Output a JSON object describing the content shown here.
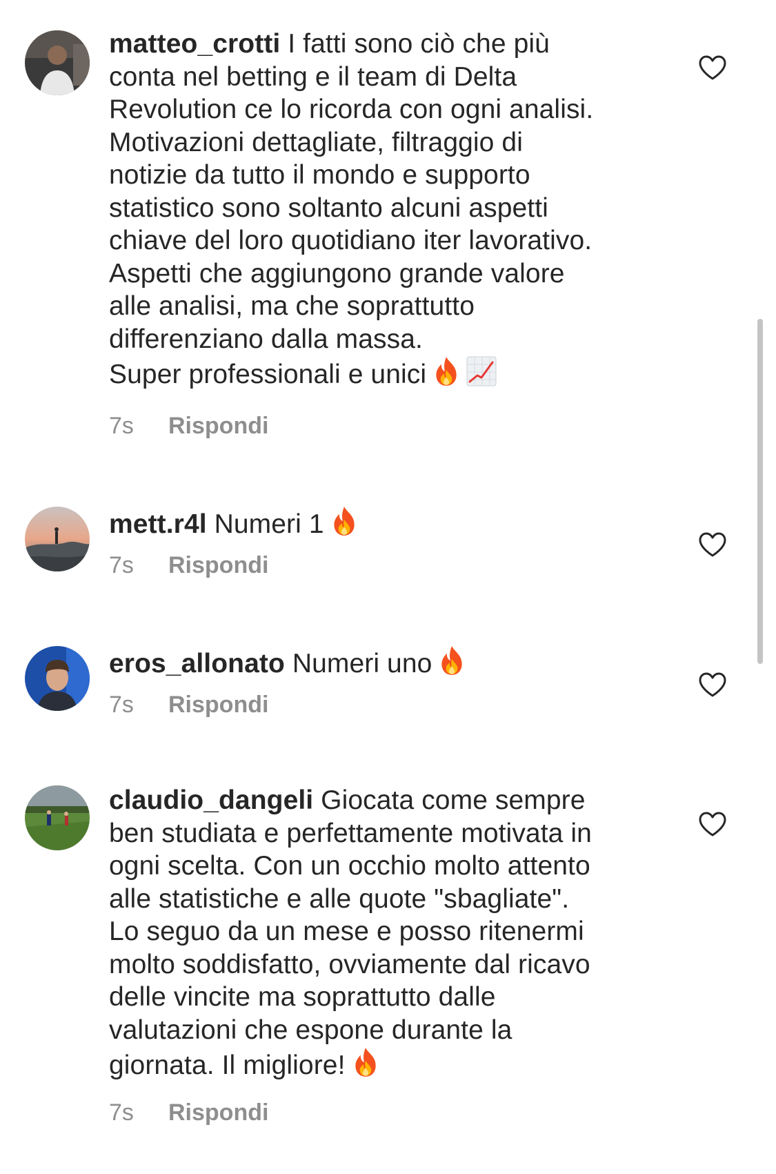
{
  "comments": [
    {
      "username": "matteo_crotti",
      "text": " I fatti sono ciò che più\nconta nel betting e il team di Delta\nRevolution ce lo ricorda con ogni analisi.\nMotivazioni dettagliate, filtraggio di\nnotizie da tutto il mondo e supporto\nstatistico sono soltanto alcuni aspetti\nchiave del loro quotidiano iter lavorativo.\nAspetti che aggiungono grande valore\nalle analisi, ma che soprattutto\ndifferenziano dalla massa.\nSuper professionali e unici",
      "emojis": [
        "fire",
        "chart-increasing"
      ],
      "time": "7s",
      "reply_label": "Rispondi"
    },
    {
      "username": "mett.r4l",
      "text": " Numeri 1",
      "emojis": [
        "fire"
      ],
      "time": "7s",
      "reply_label": "Rispondi"
    },
    {
      "username": "eros_allonato",
      "text": " Numeri uno",
      "emojis": [
        "fire"
      ],
      "time": "7s",
      "reply_label": "Rispondi"
    },
    {
      "username": "claudio_dangeli",
      "text": " Giocata come sempre\nben studiata e perfettamente motivata in\nogni scelta. Con un occhio molto attento\nalle statistiche e alle quote \"sbagliate\".\nLo seguo da un mese e posso ritenermi\nmolto soddisfatto, ovviamente dal ricavo\ndelle vincite ma soprattutto dalle\nvalutazioni che espone durante la\ngiornata. Il migliore!",
      "emojis": [
        "fire"
      ],
      "time": "7s",
      "reply_label": "Rispondi"
    }
  ],
  "icons": {
    "like": "heart-outline-icon"
  },
  "colors": {
    "text": "#262626",
    "secondary": "#8e8e8e",
    "fire": "#f4511e",
    "heart_outline": "#262626"
  }
}
